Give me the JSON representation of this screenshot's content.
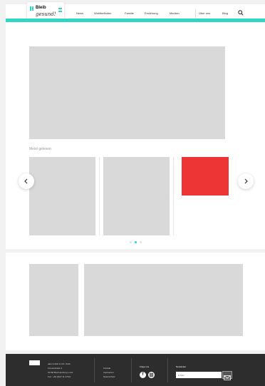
{
  "header": {
    "brand_line1": "Bleib",
    "brand_line2": "gesund!",
    "nav": [
      "News",
      "Wohlbefinden",
      "Familie",
      "Ernährung",
      "Medizin",
      "Über uns",
      "Blog"
    ],
    "accent": "#2fd6c1"
  },
  "main": {
    "section_title": "Meist gelesen",
    "carousel": {
      "dots_total": 3,
      "active_dot": 2
    }
  },
  "footer": {
    "address": [
      "aalo GmbH & CO. OHG",
      "Immenstraße 4",
      "01700 Bad Homburg v.d.H",
      "Fon: +49 (0)47 11 470-0"
    ],
    "links": [
      "Kontakt",
      "Impressum",
      "Datenschutz"
    ],
    "follow_label": "Folge uns",
    "newsletter_label": "Newsletter",
    "newsletter_placeholder": "E-Mail"
  }
}
